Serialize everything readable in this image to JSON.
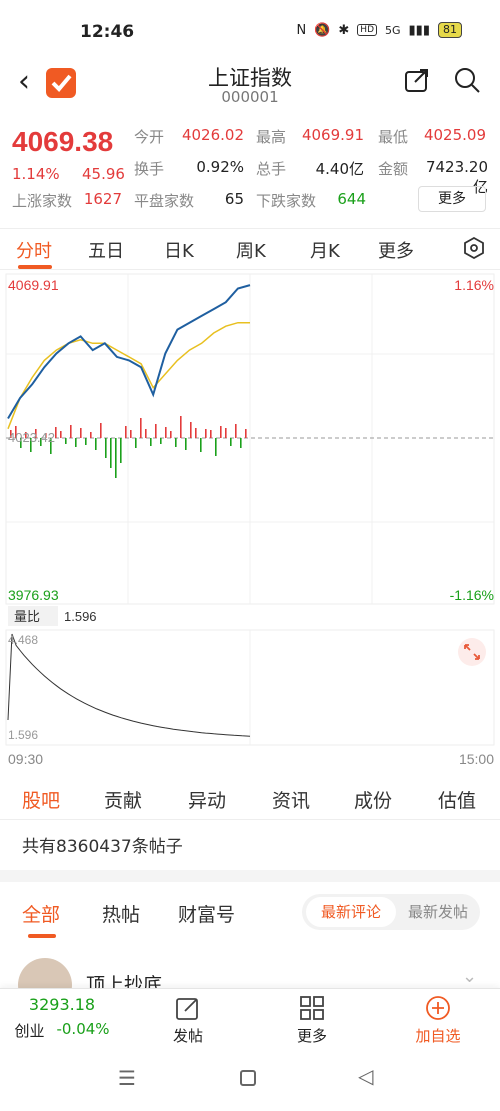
{
  "status_bar": {
    "time": "12:46",
    "network": "5G",
    "battery": "81"
  },
  "header": {
    "title": "上证指数",
    "code": "000001"
  },
  "quote": {
    "price": "4069.38",
    "change_pct": "1.14%",
    "change": "45.96",
    "open_label": "今开",
    "open": "4026.02",
    "high_label": "最高",
    "high": "4069.91",
    "low_label": "最低",
    "low": "4025.09",
    "turnover_rate_label": "换手",
    "turnover_rate": "0.92%",
    "volume_label": "总手",
    "volume": "4.40亿",
    "amount_label": "金额",
    "amount": "7423.20亿",
    "up_label": "上涨家数",
    "up": "1627",
    "flat_label": "平盘家数",
    "flat": "65",
    "down_label": "下跌家数",
    "down": "644",
    "more_label": "更多"
  },
  "chart_tabs": [
    "分时",
    "五日",
    "日K",
    "周K",
    "月K",
    "更多"
  ],
  "chart": {
    "top_price": "4069.91",
    "top_pct": "1.16%",
    "bottom_price": "3976.93",
    "bottom_pct": "-1.16%",
    "mid_price": "4023.42",
    "ratio_label": "量比",
    "ratio_value": "1.596",
    "ratio_max": "4.468",
    "ratio_min": "1.596",
    "time_start": "09:30",
    "time_end": "15:00"
  },
  "bottom_tabs": [
    "股吧",
    "贡献",
    "异动",
    "资讯",
    "成份",
    "估值"
  ],
  "posts_count": "共有8360437条帖子",
  "feed_tabs": [
    "全部",
    "热帖",
    "财富号"
  ],
  "sort": {
    "active": "最新评论",
    "other": "最新发帖"
  },
  "first_post": {
    "author": "顶上抄底"
  },
  "bottom_bar": {
    "index_value": "3293.18",
    "index_name": "创业",
    "index_change": "-0.04%",
    "post_label": "发帖",
    "more_label": "更多",
    "add_label": "加自选"
  },
  "colors": {
    "accent": "#f05a23",
    "up": "#e33b3b",
    "down": "#1aa01a",
    "price_line": "#1f5fa0",
    "avg_line": "#e8c020"
  },
  "chart_data": {
    "type": "line",
    "title": "",
    "series": [
      {
        "values": [
          4030,
          4036,
          4040,
          4045,
          4049,
          4052,
          4054,
          4050,
          4052,
          4048,
          4047,
          4045,
          4037,
          4049,
          4056,
          4058,
          4060,
          4062,
          4064,
          4068,
          4069
        ]
      },
      {
        "values": [
          4027,
          4036,
          4042,
          4047,
          4050,
          4052,
          4053,
          4052,
          4052,
          4050,
          4048,
          4046,
          4039,
          4043,
          4047,
          4050,
          4052,
          4055,
          4057,
          4058,
          4058
        ]
      }
    ],
    "ylim": [
      3976.93,
      4069.91
    ],
    "x_range": [
      "09:30",
      "15:00"
    ]
  }
}
